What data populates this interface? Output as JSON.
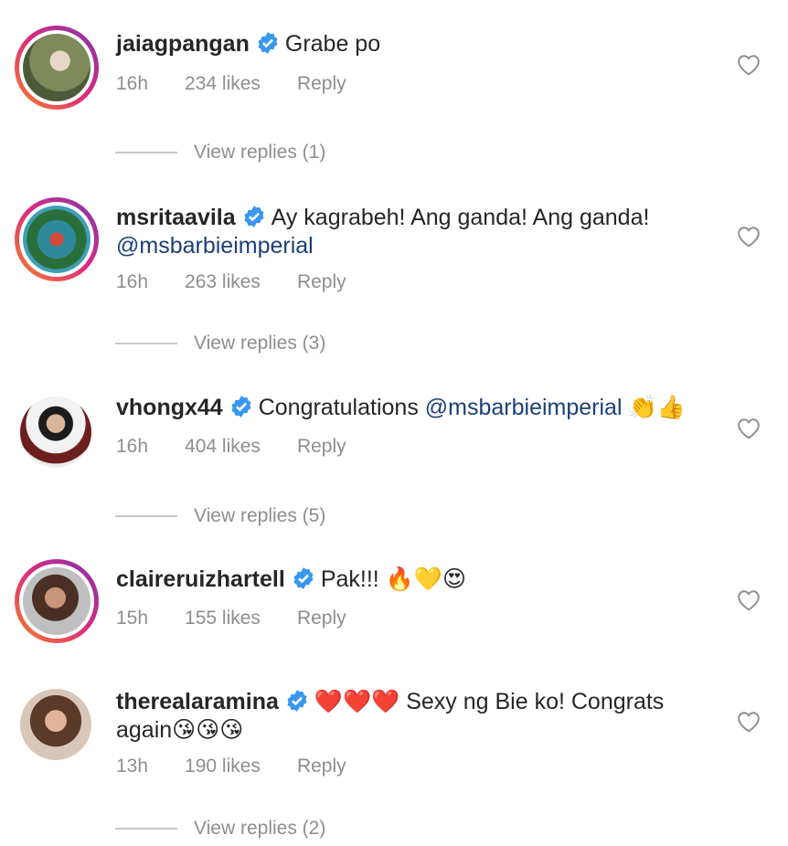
{
  "comments": [
    {
      "username": "jaiagpangan",
      "text": "Grabe po",
      "time": "16h",
      "likes": "234 likes",
      "reply": "Reply",
      "view_replies": "View replies (1)"
    },
    {
      "username": "msritaavila",
      "text": "Ay kagrabeh! Ang ganda! Ang ganda!",
      "mention": "@msbarbieimperial",
      "time": "16h",
      "likes": "263 likes",
      "reply": "Reply",
      "view_replies": "View replies (3)"
    },
    {
      "username": "vhongx44",
      "text": "Congratulations",
      "mention": "@msbarbieimperial",
      "emojis": "👏👍",
      "time": "16h",
      "likes": "404 likes",
      "reply": "Reply",
      "view_replies": "View replies (5)"
    },
    {
      "username": "claireruizhartell",
      "text": "Pak!!!",
      "emojis": "🔥💛😍",
      "time": "15h",
      "likes": "155 likes",
      "reply": "Reply"
    },
    {
      "username": "therealaramina",
      "emojis_lead": "❤️❤️❤️",
      "text": "Sexy ng Bie ko! Congrats",
      "text_cont": "again",
      "emojis": "😘😘😘",
      "time": "13h",
      "likes": "190 likes",
      "reply": "Reply",
      "view_replies": "View replies (2)"
    }
  ],
  "colors": {
    "verified": "#3897f0",
    "mention": "#1c3f79",
    "meta": "#8e8e8e",
    "story_ring": [
      "#f58529",
      "#dd2a7b",
      "#8134af"
    ]
  },
  "icons": [
    "verified-badge-icon",
    "heart-outline-icon"
  ]
}
